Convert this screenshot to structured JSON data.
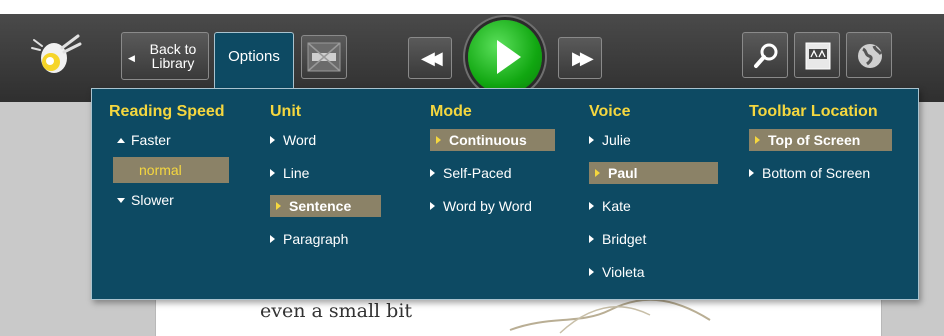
{
  "toolbar": {
    "back_label_line1": "Back to",
    "back_label_line2": "Library",
    "options_tab": "Options"
  },
  "icons": {
    "logo": "firefly-logo-icon",
    "screen": "screen-mask-icon",
    "rewind": "rewind-icon",
    "play": "play-icon",
    "fast_forward": "fast-forward-icon",
    "zoom": "magnify-icon",
    "font": "font-size-icon",
    "globe": "globe-icon"
  },
  "colors": {
    "panel_bg": "#0d4a63",
    "heading": "#f5d73f",
    "selected_bg": "#8b8267",
    "play_green": "#11a711"
  },
  "options": {
    "reading_speed": {
      "heading": "Reading Speed",
      "faster": "Faster",
      "current": "normal",
      "slower": "Slower"
    },
    "unit": {
      "heading": "Unit",
      "items": [
        "Word",
        "Line",
        "Sentence",
        "Paragraph"
      ],
      "selected": "Sentence"
    },
    "mode": {
      "heading": "Mode",
      "items": [
        "Continuous",
        "Self-Paced",
        "Word by Word"
      ],
      "selected": "Continuous"
    },
    "voice": {
      "heading": "Voice",
      "items": [
        "Julie",
        "Paul",
        "Kate",
        "Bridget",
        "Violeta"
      ],
      "selected": "Paul"
    },
    "toolbar_location": {
      "heading": "Toolbar Location",
      "items": [
        "Top of Screen",
        "Bottom of Screen"
      ],
      "selected": "Top of Screen"
    }
  },
  "page": {
    "text_line1": "even a small bit"
  }
}
